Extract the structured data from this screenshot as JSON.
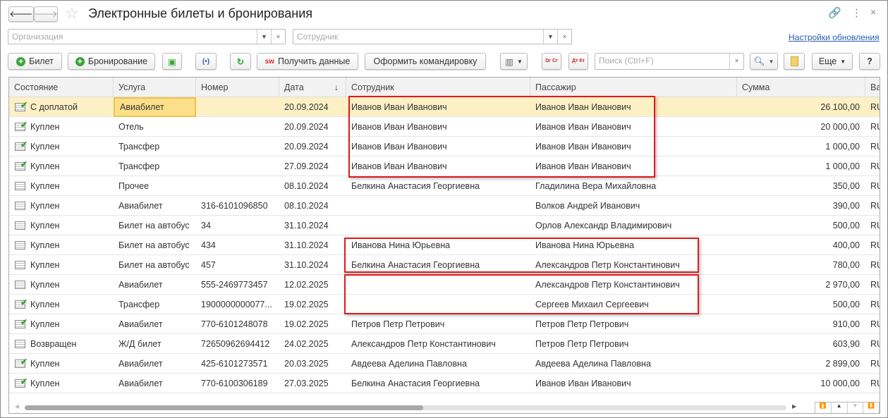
{
  "window": {
    "title": "Электронные билеты и бронирования",
    "back_icon": "arrow-left-icon",
    "forward_icon": "arrow-right-icon",
    "favorite_icon": "star-icon",
    "link_icon": "link-icon",
    "more_icon": "kebab-icon",
    "close_icon": "close-icon"
  },
  "filters": {
    "organization_placeholder": "Организация",
    "employee_placeholder": "Сотрудник",
    "update_settings_link": "Настройки обновления"
  },
  "toolbar": {
    "ticket": "Билет",
    "booking": "Бронирование",
    "get_data": "Получить данные",
    "get_data_badge": "sw",
    "trip": "Оформить командировку",
    "dr_cr": "Dr Cr",
    "dt_kt": "Дт Кт",
    "search_placeholder": "Поиск (Ctrl+F)",
    "more": "Еще",
    "help": "?"
  },
  "table": {
    "columns": [
      "Состояние",
      "Услуга",
      "Номер",
      "Дата",
      "Сотрудник",
      "Пассажир",
      "Сумма",
      "Ва"
    ],
    "sort_indicator": "↓",
    "rows": [
      {
        "state": "С доплатой",
        "checked": true,
        "service": "Авиабилет",
        "number": "",
        "date": "20.09.2024",
        "employee": "Иванов Иван Иванович",
        "passenger": "Иванов Иван Иванович",
        "sum": "26 100,00",
        "cur": "RU"
      },
      {
        "state": "Куплен",
        "checked": true,
        "service": "Отель",
        "number": "",
        "date": "20.09.2024",
        "employee": "Иванов Иван Иванович",
        "passenger": "Иванов Иван Иванович",
        "sum": "20 000,00",
        "cur": "RU"
      },
      {
        "state": "Куплен",
        "checked": true,
        "service": "Трансфер",
        "number": "",
        "date": "20.09.2024",
        "employee": "Иванов Иван Иванович",
        "passenger": "Иванов Иван Иванович",
        "sum": "1 000,00",
        "cur": "RU"
      },
      {
        "state": "Куплен",
        "checked": true,
        "service": "Трансфер",
        "number": "",
        "date": "27.09.2024",
        "employee": "Иванов Иван Иванович",
        "passenger": "Иванов Иван Иванович",
        "sum": "1 000,00",
        "cur": "RU"
      },
      {
        "state": "Куплен",
        "checked": false,
        "service": "Прочее",
        "number": "",
        "date": "08.10.2024",
        "employee": "Белкина Анастасия Георгиевна",
        "passenger": "Гладилина Вера Михайловна",
        "sum": "350,00",
        "cur": "RU"
      },
      {
        "state": "Куплен",
        "checked": false,
        "service": "Авиабилет",
        "number": "316-6101096850",
        "date": "08.10.2024",
        "employee": "",
        "passenger": "Волков Андрей Иванович",
        "sum": "390,00",
        "cur": "RU"
      },
      {
        "state": "Куплен",
        "checked": false,
        "service": "Билет на автобус",
        "number": "34",
        "date": "31.10.2024",
        "employee": "",
        "passenger": "Орлов Александр Владимирович",
        "sum": "500,00",
        "cur": "RU"
      },
      {
        "state": "Куплен",
        "checked": false,
        "service": "Билет на автобус",
        "number": "434",
        "date": "31.10.2024",
        "employee": "Иванова Нина Юрьевна",
        "passenger": "Иванова Нина Юрьевна",
        "sum": "400,00",
        "cur": "RU"
      },
      {
        "state": "Куплен",
        "checked": false,
        "service": "Билет на автобус",
        "number": "457",
        "date": "31.10.2024",
        "employee": "Белкина Анастасия Георгиевна",
        "passenger": "Александров Петр Константинович",
        "sum": "780,00",
        "cur": "RU"
      },
      {
        "state": "Куплен",
        "checked": false,
        "service": "Авиабилет",
        "number": "555-2469773457",
        "date": "12.02.2025",
        "employee": "",
        "passenger": "Александров Петр Константинович",
        "sum": "2 970,00",
        "cur": "RU"
      },
      {
        "state": "Куплен",
        "checked": true,
        "service": "Трансфер",
        "number": "1900000000077...",
        "date": "19.02.2025",
        "employee": "",
        "passenger": "Сергеев Михаил Сергеевич",
        "sum": "500,00",
        "cur": "RU"
      },
      {
        "state": "Куплен",
        "checked": true,
        "service": "Авиабилет",
        "number": "770-6101248078",
        "date": "19.02.2025",
        "employee": "Петров Петр Петрович",
        "passenger": "Петров Петр Петрович",
        "sum": "910,00",
        "cur": "RU"
      },
      {
        "state": "Возвращен",
        "checked": false,
        "service": "Ж/Д билет",
        "number": "72650962694412",
        "date": "24.02.2025",
        "employee": "Александров Петр Константинович",
        "passenger": "Петров Петр Петрович",
        "sum": "603,90",
        "cur": "RU"
      },
      {
        "state": "Куплен",
        "checked": true,
        "service": "Авиабилет",
        "number": "425-6101273571",
        "date": "20.03.2025",
        "employee": "Авдеева Аделина Павловна",
        "passenger": "Авдеева Аделина Павловна",
        "sum": "2 899,00",
        "cur": "RU"
      },
      {
        "state": "Куплен",
        "checked": true,
        "service": "Авиабилет",
        "number": "770-6100306189",
        "date": "27.03.2025",
        "employee": "Белкина Анастасия Георгиевна",
        "passenger": "Иванов Иван Иванович",
        "sum": "10 000,00",
        "cur": "RU"
      }
    ]
  },
  "colors": {
    "highlight_box": "#e01b1b",
    "selected_row": "#fdf0c4",
    "link": "#2a5db0"
  }
}
